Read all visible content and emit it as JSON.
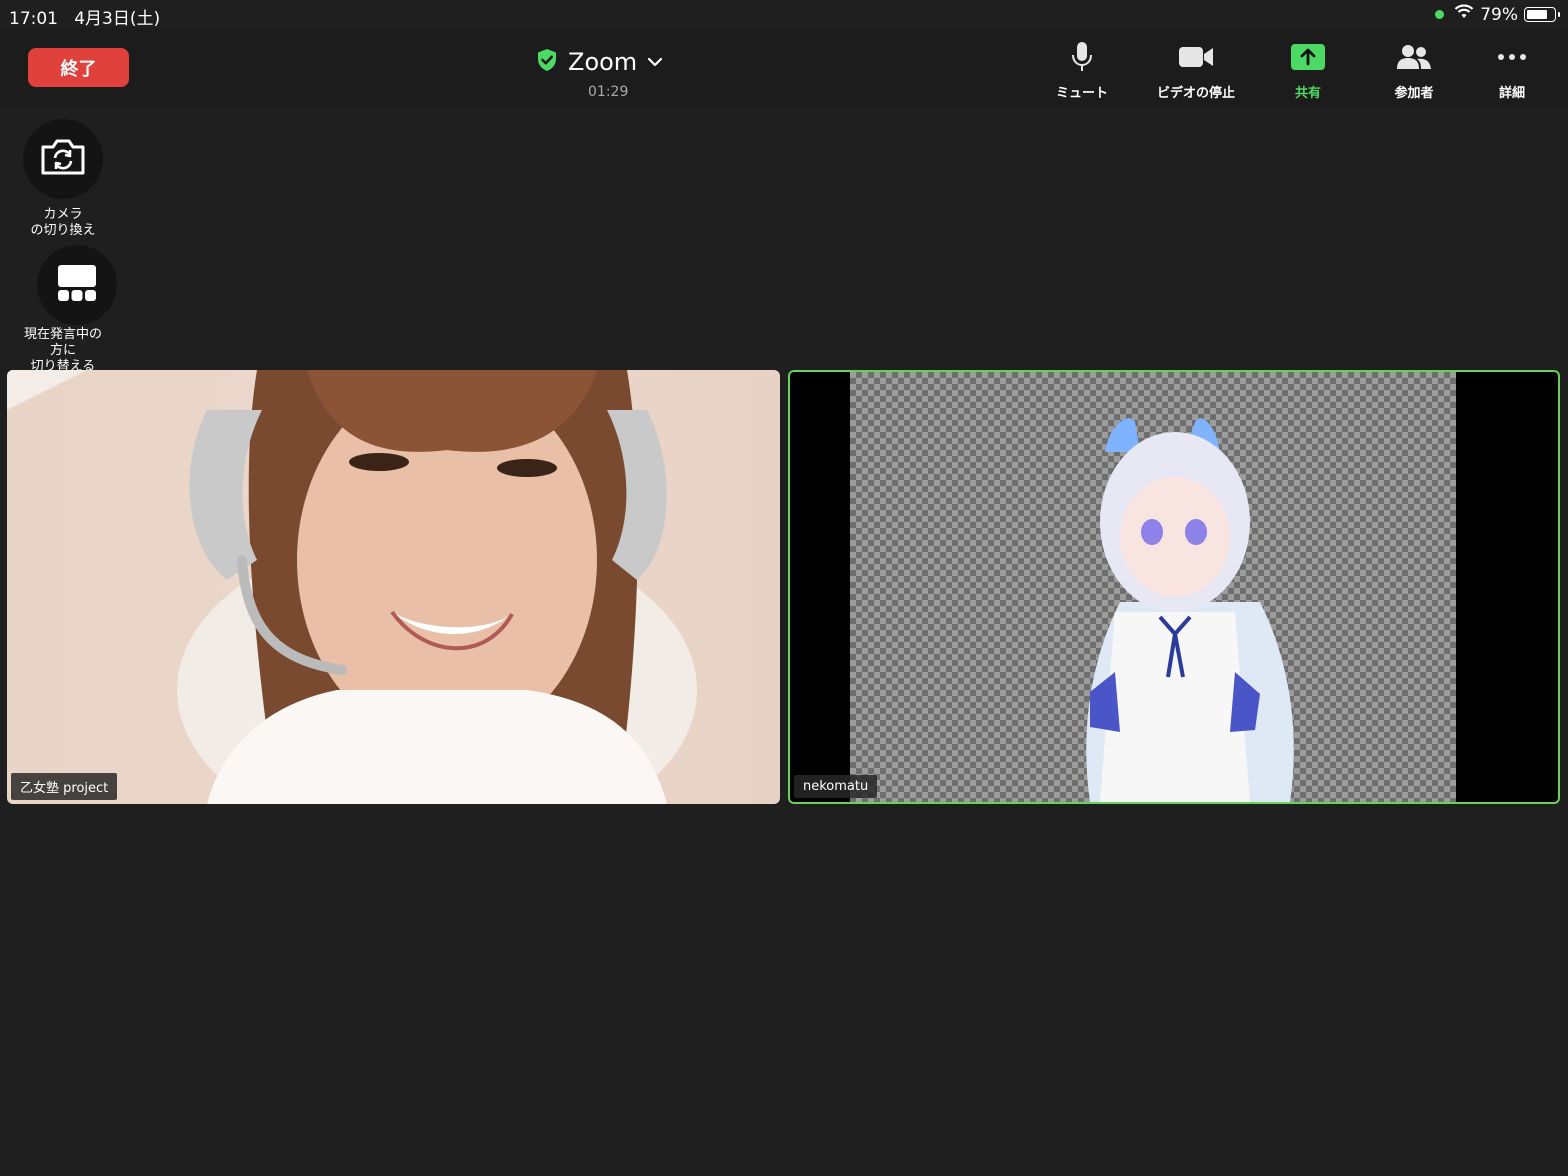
{
  "status_bar": {
    "time": "17:01",
    "date": "4月3日(土)",
    "battery": "79%",
    "battery_fraction": 0.79
  },
  "header": {
    "end_label": "終了",
    "title": "Zoom",
    "timer": "01:29"
  },
  "toolbar": {
    "mute": "ミュート",
    "video": "ビデオの停止",
    "share": "共有",
    "participants": "参加者",
    "more": "詳細"
  },
  "side_controls": {
    "camera_label_line1": "カメラ",
    "camera_label_line2": "の切り換え",
    "speaker_label_line1": "現在発言中の",
    "speaker_label_line2": "方に",
    "speaker_label_line3": "切り替える"
  },
  "participants": [
    {
      "name": "乙女塾 project"
    },
    {
      "name": "nekomatu"
    }
  ],
  "colors": {
    "accent_green": "#4cd964",
    "end_red": "#e0413d",
    "active_border": "#6ad15a"
  }
}
